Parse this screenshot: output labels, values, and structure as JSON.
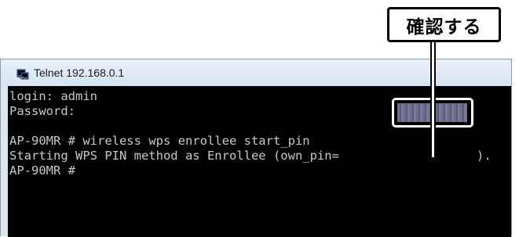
{
  "callout": {
    "label": "確認する"
  },
  "window": {
    "title": "Telnet 192.168.0.1",
    "icon": "telnet-terminal-icon"
  },
  "terminal": {
    "lines": [
      "login: admin",
      "Password:",
      "",
      "AP-90MR # wireless wps enrollee start_pin",
      "Starting WPS PIN method as Enrollee (own_pin=",
      "AP-90MR #"
    ],
    "pin_suffix": ")."
  },
  "colors": {
    "terminal_bg": "#000000",
    "terminal_fg": "#c8c8c8",
    "callout_border": "#000000"
  }
}
